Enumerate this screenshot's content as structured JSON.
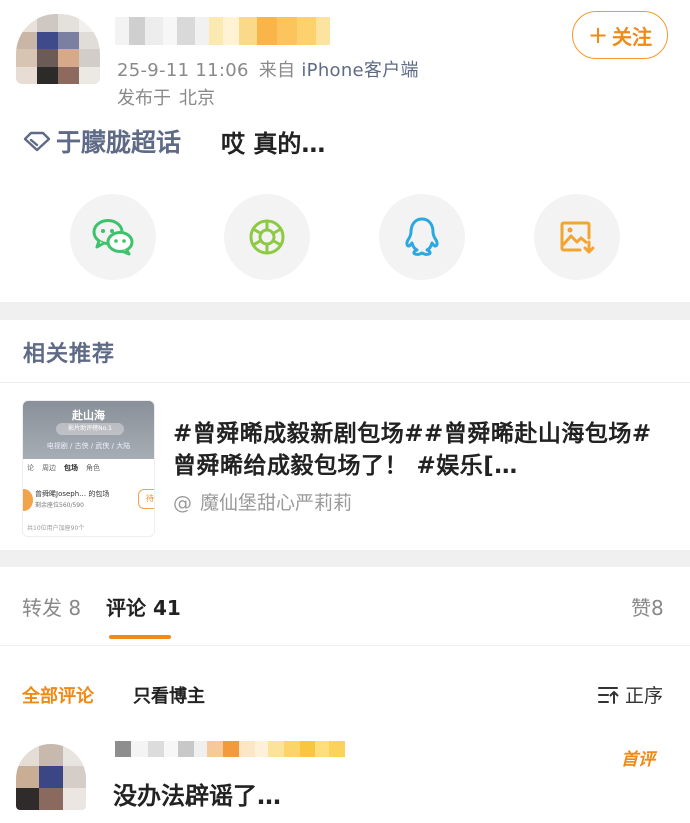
{
  "post": {
    "meta": {
      "date": "25-9-11 11:06",
      "source_label": "来自",
      "source_app": "iPhone客户端",
      "location_label": "发布于",
      "location": "北京"
    },
    "follow_label": "关注",
    "supertopic": "于朦胧超话",
    "text": "哎 真的…"
  },
  "share": {
    "icons": [
      "wechat-icon",
      "moments-icon",
      "qq-icon",
      "save-image-icon"
    ],
    "colors": {
      "wechat": "#3cc36b",
      "moments": "#8ec943",
      "qq": "#2aa8e0",
      "save": "#f2a530"
    }
  },
  "related": {
    "title": "相关推荐",
    "card": {
      "thumb": {
        "title": "赴山海",
        "subtitle": "影片助评榜No.1",
        "meta": "电视剧 / 古侠 / 武侠 / 大陆",
        "tabs": [
          "论",
          "周边",
          "包场",
          "角色"
        ],
        "active_tab": "包场",
        "row_text": "曾舜晞Joseph… 的包场",
        "row_sub": "剩余座位560/590",
        "pill": "待",
        "footer": "共10位用户加座90个"
      },
      "text": "#曾舜晞成毅新剧包场##曾舜晞赴山海包场#曾舜晞给成毅包场了！ #娱乐[…",
      "author_prefix": "@",
      "author": "魔仙堡甜心严莉莉"
    }
  },
  "tabs": {
    "repost": {
      "label": "转发",
      "count": "8"
    },
    "comment": {
      "label": "评论",
      "count": "41"
    },
    "like": {
      "label": "赞",
      "count": "8"
    }
  },
  "filters": {
    "all": "全部评论",
    "op_only": "只看博主",
    "sort": "正序"
  },
  "comment": {
    "badge": "首评",
    "text": "没办法辟谣了…"
  },
  "colors": {
    "accent": "#f08a16",
    "link": "#5f6b86",
    "muted": "#8a8a8a",
    "divider": "#f0f0f0"
  }
}
